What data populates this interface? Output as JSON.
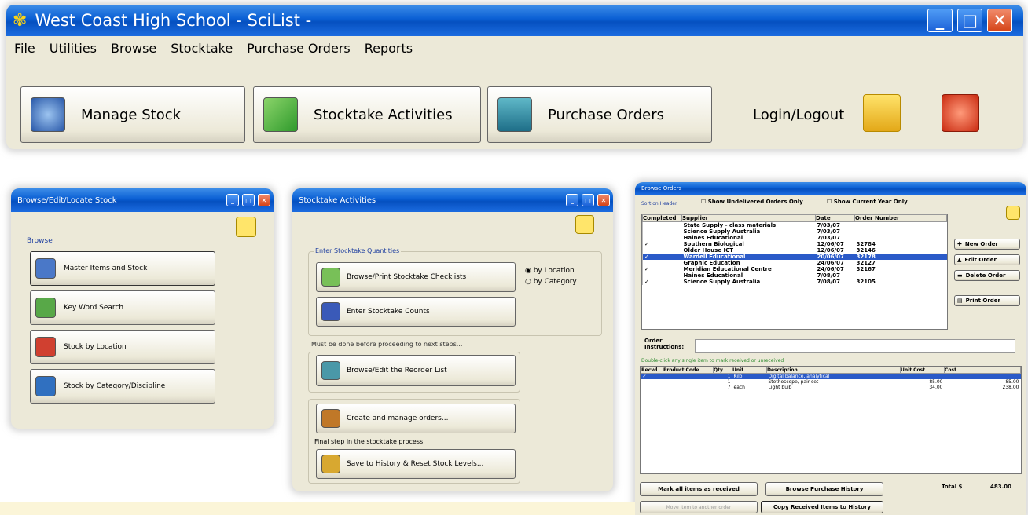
{
  "main": {
    "title": "West Coast High School - SciList -",
    "menu": [
      "File",
      "Utilities",
      "Browse",
      "Stocktake",
      "Purchase Orders",
      "Reports"
    ],
    "buttons": [
      {
        "label": "Manage Stock",
        "accel": "M"
      },
      {
        "label": "Stocktake Activities",
        "accel": "S"
      },
      {
        "label": "Purchase Orders",
        "accel": "P"
      }
    ],
    "login": "Login/Logout"
  },
  "browse": {
    "title": "Browse/Edit/Locate Stock",
    "group": "Browse",
    "items": [
      "Master Items and Stock",
      "Key Word Search",
      "Stock by Location",
      "Stock by Category/Discipline"
    ]
  },
  "stocktake": {
    "title": "Stocktake Activities",
    "group": "Enter Stocktake Quantities",
    "b1": "Browse/Print Stocktake Checklists",
    "b2": "Enter Stocktake Counts",
    "r1": "by Location",
    "r2": "by Category",
    "note1": "Must be done before proceeding to next steps...",
    "b3": "Browse/Edit the Reorder List",
    "b4": "Create and manage orders...",
    "note2": "Final step in the stocktake process",
    "b5": "Save to History & Reset Stock Levels..."
  },
  "orders": {
    "title": "Browse Orders",
    "cb1": "Show Undelivered Orders Only",
    "cb2": "Show Current Year Only",
    "lbl": "Sort on Header",
    "cols": [
      "Completed",
      "Supplier",
      "Date",
      "Order Number"
    ],
    "rows": [
      {
        "c": "",
        "s": "State Supply - class materials",
        "d": "7/03/07",
        "n": ""
      },
      {
        "c": "",
        "s": "Science Supply Australia",
        "d": "7/03/07",
        "n": ""
      },
      {
        "c": "",
        "s": "Haines Educational",
        "d": "7/03/07",
        "n": ""
      },
      {
        "c": "✓",
        "s": "Southern Biological",
        "d": "12/06/07",
        "n": "32784"
      },
      {
        "c": "",
        "s": "Older House ICT",
        "d": "12/06/07",
        "n": "32146"
      },
      {
        "c": "✓",
        "s": "Wardell Educational",
        "d": "20/06/07",
        "n": "32178"
      },
      {
        "c": "",
        "s": "Graphic Education",
        "d": "24/06/07",
        "n": "32127"
      },
      {
        "c": "✓",
        "s": "Meridian Educational Centre",
        "d": "24/06/07",
        "n": "32167"
      },
      {
        "c": "",
        "s": "Haines Educational",
        "d": "7/08/07",
        "n": ""
      },
      {
        "c": "✓",
        "s": "Science Supply Australia",
        "d": "7/08/07",
        "n": "32105"
      }
    ],
    "new": "New Order",
    "edit": "Edit Order",
    "del": "Delete Order",
    "print": "Print Order",
    "instr": "Order Instructions:",
    "hint": "Double-click any single item to mark received or unreceived",
    "icols": [
      "Recvd",
      "Product Code",
      "Qty",
      "Unit",
      "Description",
      "Unit Cost",
      "Cost"
    ],
    "items": [
      {
        "r": "✓",
        "p": "",
        "q": "1",
        "u": "Kilo",
        "d": "Digital balance, analytical",
        "uc": "",
        "c": ""
      },
      {
        "r": "",
        "p": "",
        "q": "1",
        "u": "",
        "d": "Stethoscope, pair set",
        "uc": "85.00",
        "c": "85.00"
      },
      {
        "r": "",
        "p": "",
        "q": "7",
        "u": "each",
        "d": "Light bulb",
        "uc": "34.00",
        "c": "238.00"
      }
    ],
    "mark": "Mark all items as received",
    "history": "Browse Purchase History",
    "move": "Move item to another order",
    "copy": "Copy Received Items to History",
    "total_lbl": "Total $",
    "total": "483.00"
  }
}
